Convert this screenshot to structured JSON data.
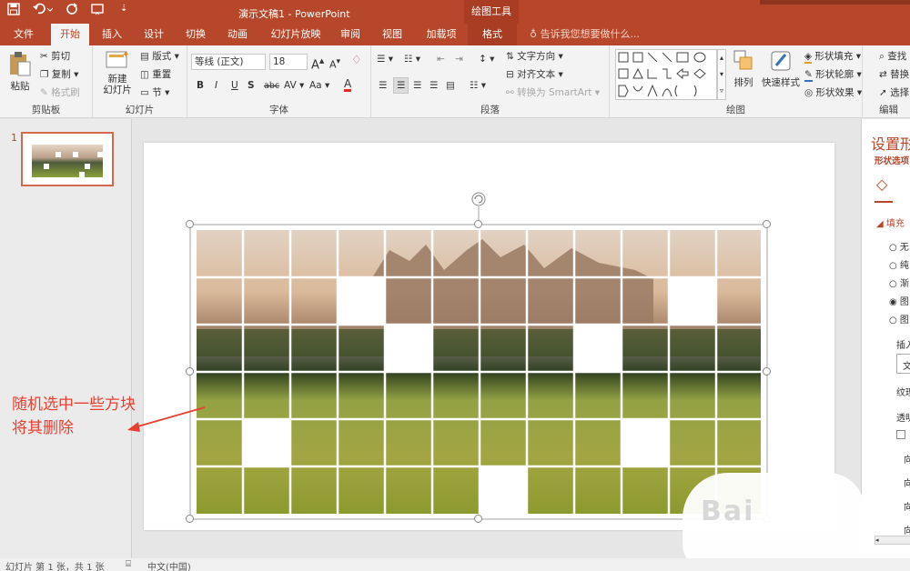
{
  "window": {
    "doc_title": "演示文稿1 - PowerPoint",
    "context_group": "绘图工具"
  },
  "tabs": [
    "文件",
    "开始",
    "插入",
    "设计",
    "切换",
    "动画",
    "幻灯片放映",
    "审阅",
    "视图",
    "加载项",
    "格式"
  ],
  "tell_me": "告诉我您想要做什么...",
  "clipboard": {
    "paste": "粘贴",
    "cut": "剪切",
    "copy": "复制",
    "format_painter": "格式刷",
    "label": "剪贴板"
  },
  "slides_group": {
    "new_slide": "新建\n幻灯片",
    "layout": "版式",
    "reset": "重置",
    "section": "节",
    "label": "幻灯片"
  },
  "font": {
    "name": "等线 (正文)",
    "size": "18",
    "label": "字体",
    "bold": "B",
    "italic": "I",
    "underline": "U",
    "shadow": "S",
    "strike": "abc",
    "spacing": "AV",
    "case": "Aa",
    "color": "A",
    "grow": "A",
    "shrink": "A"
  },
  "paragraph": {
    "text_dir": "文字方向",
    "align_text": "对齐文本",
    "smartart": "转换为 SmartArt",
    "label": "段落"
  },
  "drawing": {
    "arrange": "排列",
    "quick_styles": "快速样式",
    "fill": "形状填充",
    "outline": "形状轮廓",
    "effects": "形状效果",
    "label": "绘图"
  },
  "editing": {
    "find": "查找",
    "replace": "替换",
    "select": "选择",
    "label": "编辑"
  },
  "thumb": {
    "number": "1"
  },
  "annotation": {
    "line1": "随机选中一些方块",
    "line2": "将其删除"
  },
  "format_pane": {
    "title": "设置形",
    "subtitle": "形状选项",
    "fill": "填充",
    "opts": [
      "无",
      "纯",
      "渐",
      "图",
      "图"
    ],
    "insert": "插入",
    "insert_btn": "文",
    "texture": "纹理",
    "transparency": "透明",
    "dirs": [
      "向",
      "向",
      "向",
      "向"
    ]
  },
  "status": {
    "slide_info": "幻灯片 第 1 张，共 1 张",
    "language": "中文(中国)"
  },
  "watermark": "Bai",
  "colors": {
    "accent": "#b7472a",
    "annotation": "#e84030"
  }
}
